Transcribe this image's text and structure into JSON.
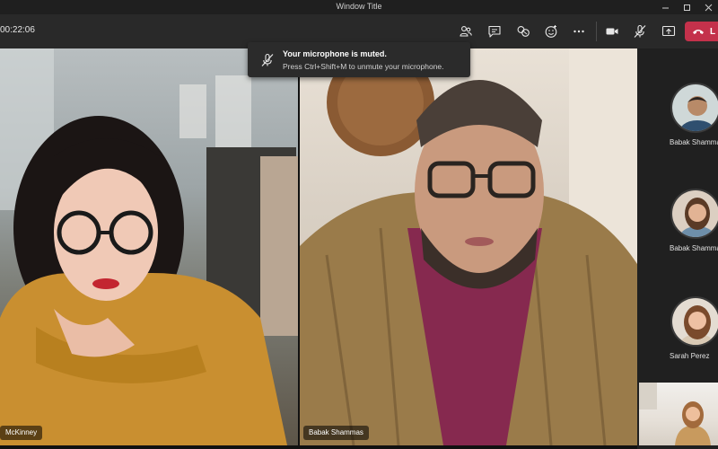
{
  "window": {
    "title": "Window Title"
  },
  "toolbar": {
    "timer": "00:22:06",
    "icons": [
      "people-icon",
      "chat-icon",
      "raise-hand-icon",
      "reactions-icon",
      "more-icon",
      "camera-icon",
      "mic-off-icon",
      "share-screen-icon",
      "phone-hangup-icon"
    ],
    "leave_label": "L"
  },
  "notification": {
    "title": "Your microphone is muted.",
    "message": "Press Ctrl+Shift+M to unmute your microphone."
  },
  "stage": {
    "tiles": [
      {
        "name": "McKinney"
      },
      {
        "name": "Babak Shammas"
      }
    ]
  },
  "roster": {
    "participants": [
      {
        "name": "Babak Shamma"
      },
      {
        "name": "Babak Shamma"
      },
      {
        "name": "Sarah Perez"
      }
    ]
  },
  "colors": {
    "leave": "#c4314b",
    "toolbar_bg": "#292929",
    "window_bg": "#1f1f1f"
  }
}
